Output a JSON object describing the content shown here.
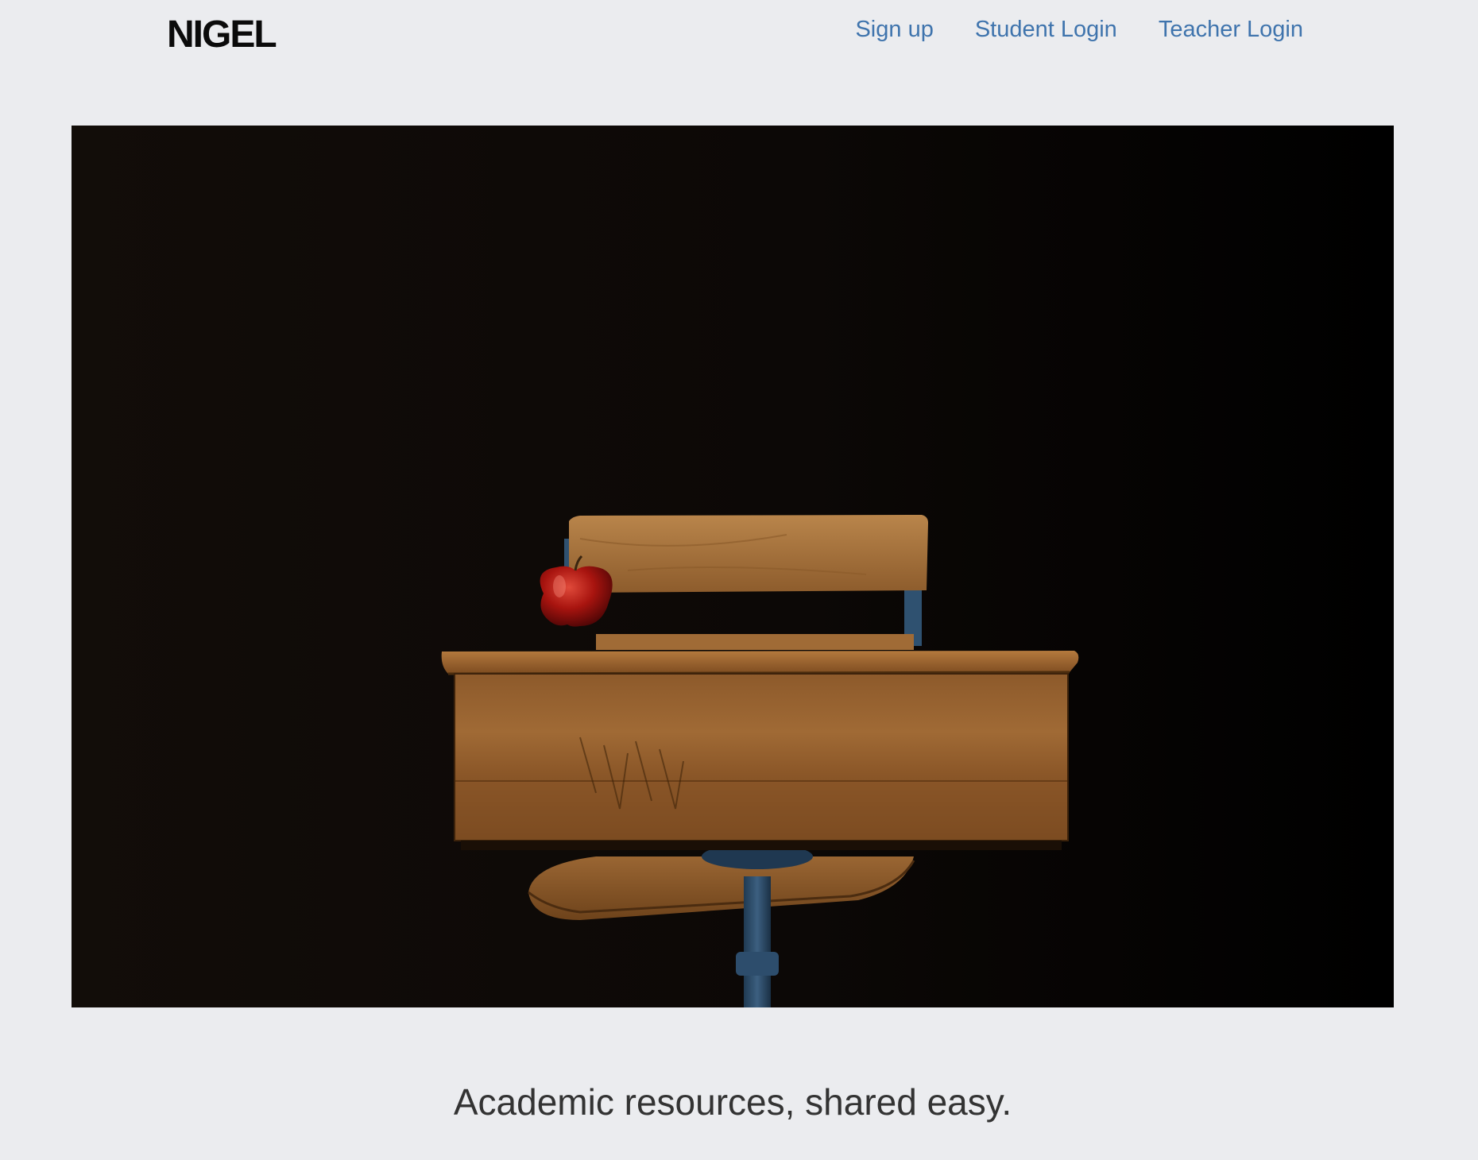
{
  "brand": {
    "name": "NIGEL"
  },
  "nav": {
    "items": [
      {
        "label": "Sign up"
      },
      {
        "label": "Student Login"
      },
      {
        "label": "Teacher Login"
      }
    ]
  },
  "hero": {
    "image": "vintage school desk with red apple on black background"
  },
  "tagline": "Academic resources, shared easy.",
  "colors": {
    "background": "#ebecef",
    "link": "#3f74ad",
    "logo": "#0b0b0b",
    "tagline": "#333333"
  }
}
